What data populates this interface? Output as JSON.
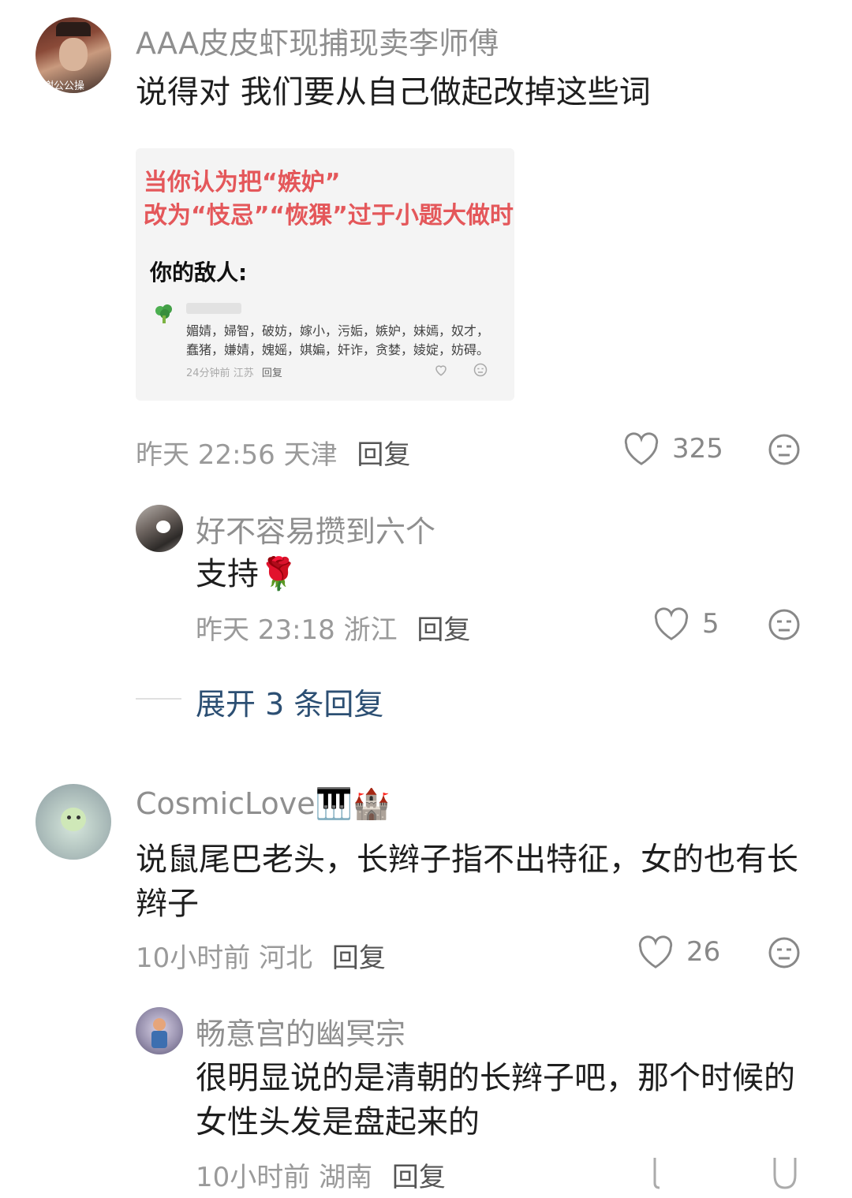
{
  "comments": [
    {
      "username": "AAA皮皮虾现捕现卖李师傅",
      "avatar_caption": "谢公公操",
      "text": "说得对 我们要从自己做起改掉这些词",
      "image": {
        "line1": "当你认为把“嫉妒”",
        "line2": "改为“忮忌”“恢猓”过于小题大做时",
        "label": "你的敌人:",
        "words_line1": "媚婧，婦智，破妨，嫁小，污姤，嫉妒，妹嫣，奴才，",
        "words_line2": "蠢猪，嫌婧，媿媱，娸媥，奸诈，贪婪，婈婝，妨碍。",
        "meta_time": "24分钟前",
        "meta_loc": "江苏",
        "meta_reply": "回复"
      },
      "time": "昨天 22:56",
      "location": "天津",
      "reply_label": "回复",
      "likes": "325",
      "replies": [
        {
          "username": "好不容易攒到六个",
          "text": "支持🌹",
          "time": "昨天 23:18",
          "location": "浙江",
          "reply_label": "回复",
          "likes": "5"
        }
      ],
      "expand_label": "展开 3 条回复"
    },
    {
      "username": "CosmicLove🎹🏰",
      "text": "说鼠尾巴老头，长辫子指不出特征，女的也有长辫子",
      "time": "10小时前",
      "location": "河北",
      "reply_label": "回复",
      "likes": "26",
      "replies": [
        {
          "username": "畅意宫的幽冥宗",
          "text": "很明显说的是清朝的长辫子吧，那个时候的女性头发是盘起来的",
          "time": "10小时前",
          "location": "湖南",
          "reply_label": "回复"
        }
      ]
    }
  ],
  "icons": {
    "like": "heart-outline-icon",
    "dislike": "meh-face-icon"
  },
  "colors": {
    "meta_gray": "#9a9a9a",
    "expand_blue": "#2c4f73",
    "image_red": "#e4575a"
  }
}
